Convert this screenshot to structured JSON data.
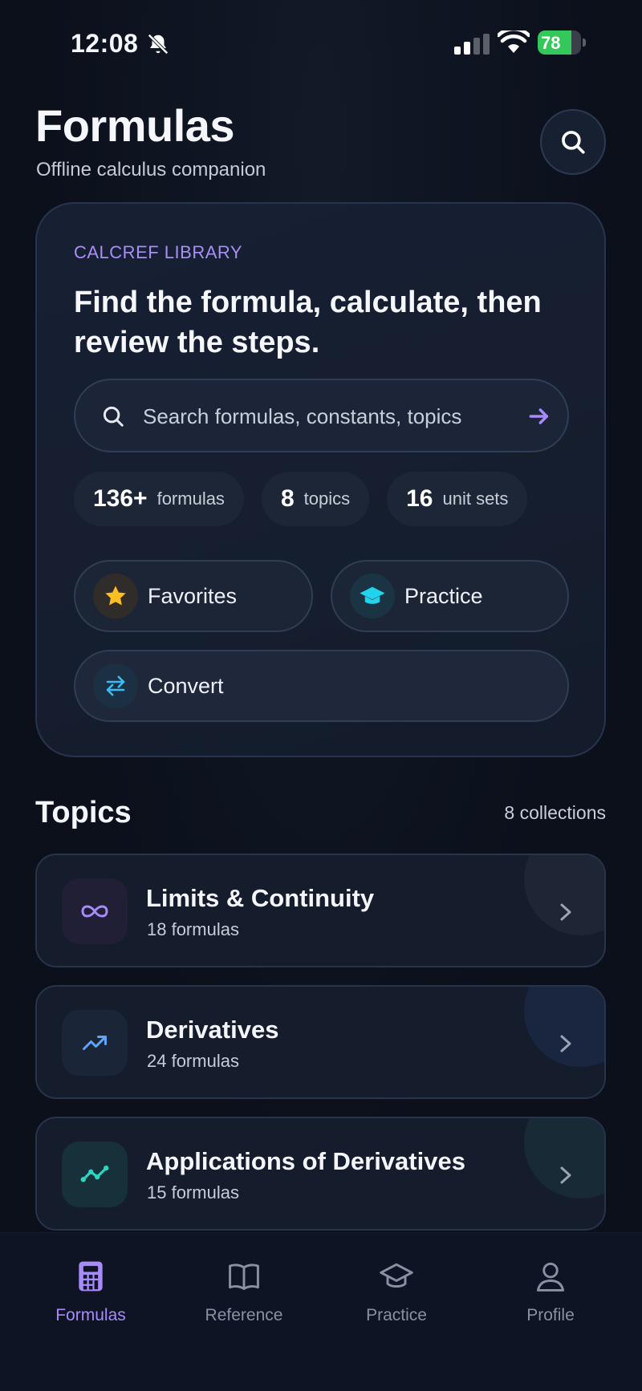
{
  "status": {
    "time": "12:08",
    "battery": "78",
    "battery_level": 0.78
  },
  "header": {
    "title": "Formulas",
    "subtitle": "Offline calculus companion"
  },
  "hero": {
    "eyebrow": "CALCREF LIBRARY",
    "headline": "Find the formula, calculate, then review the steps.",
    "search_placeholder": "Search formulas, constants, topics",
    "stats": [
      {
        "num": "136+",
        "label": "formulas"
      },
      {
        "num": "8",
        "label": "topics"
      },
      {
        "num": "16",
        "label": "unit sets"
      }
    ],
    "actions": {
      "favorites": "Favorites",
      "practice": "Practice",
      "convert": "Convert"
    }
  },
  "topics": {
    "title": "Topics",
    "count": "8 collections",
    "items": [
      {
        "name": "Limits & Continuity",
        "sub": "18 formulas",
        "icon": "infinity-icon",
        "color": "#a78bfa"
      },
      {
        "name": "Derivatives",
        "sub": "24 formulas",
        "icon": "trend-up-icon",
        "color": "#60a5fa"
      },
      {
        "name": "Applications of Derivatives",
        "sub": "15 formulas",
        "icon": "line-chart-icon",
        "color": "#2dd4bf"
      }
    ]
  },
  "nav": {
    "tabs": [
      {
        "label": "Formulas",
        "icon": "calculator-icon",
        "active": true
      },
      {
        "label": "Reference",
        "icon": "book-icon"
      },
      {
        "label": "Practice",
        "icon": "graduation-cap-icon"
      },
      {
        "label": "Profile",
        "icon": "user-icon"
      }
    ]
  },
  "colors": {
    "accent": "#a78bfa",
    "favorite": "#fbbf24",
    "practice": "#22d3ee",
    "convert": "#38bdf8",
    "battery": "#34c759"
  }
}
